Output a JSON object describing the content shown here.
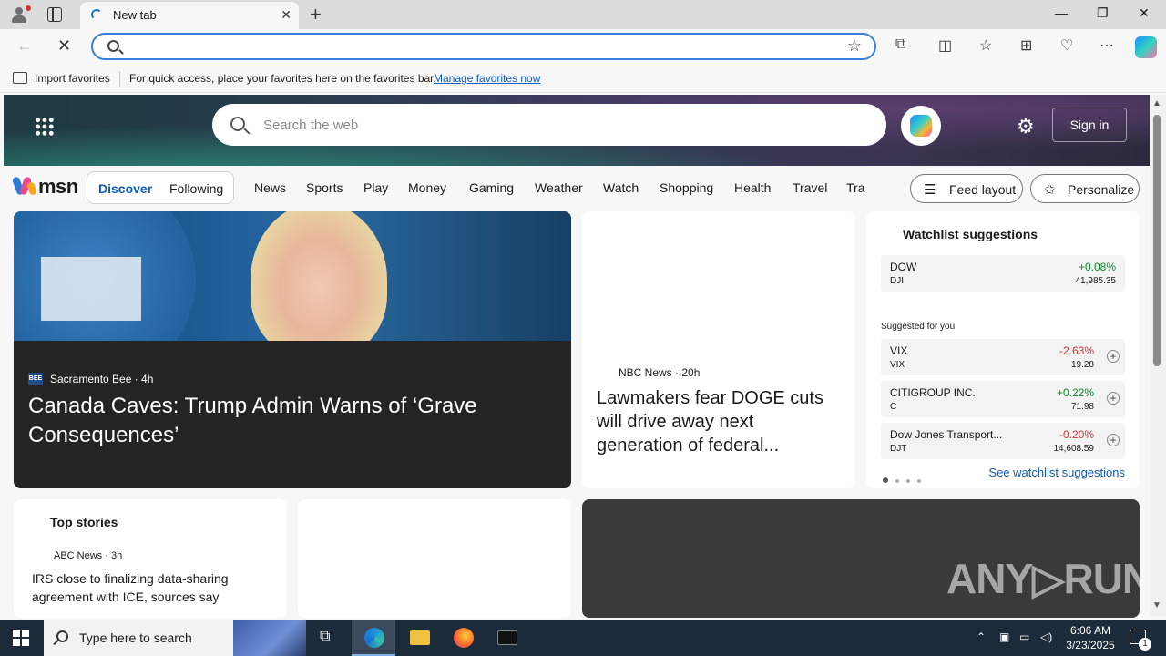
{
  "browser": {
    "tab_title": "New tab",
    "favorites_bar": {
      "import_label": "Import favorites",
      "message": "For quick access, place your favorites here on the favorites bar.",
      "manage_link": "Manage favorites now"
    }
  },
  "msn": {
    "search_placeholder": "Search the web",
    "sign_in": "Sign in",
    "logo_text": "msn",
    "feed_tabs": [
      "Discover",
      "Following"
    ],
    "categories": [
      "News",
      "Sports",
      "Play",
      "Money",
      "Gaming",
      "Weather",
      "Watch",
      "Shopping",
      "Health",
      "Travel",
      "Tra"
    ],
    "feed_layout_label": "Feed layout",
    "personalize_label": "Personalize",
    "hero": {
      "source_badge": "BEE",
      "source": "Sacramento Bee · 4h",
      "title": "Canada Caves: Trump Admin Warns of ‘Grave Consequences’"
    },
    "mid_story": {
      "source": "NBC News · 20h",
      "title": "Lawmakers fear DOGE cuts will drive away next generation of federal..."
    },
    "watchlist": {
      "title": "Watchlist suggestions",
      "suggested_label": "Suggested for you",
      "see_link": "See watchlist suggestions",
      "main": {
        "name": "DOW",
        "ticker": "DJI",
        "change": "+0.08%",
        "price": "41,985.35"
      },
      "stocks": [
        {
          "name": "VIX",
          "ticker": "VIX",
          "change": "-2.63%",
          "price": "19.28"
        },
        {
          "name": "CITIGROUP INC.",
          "ticker": "C",
          "change": "+0.22%",
          "price": "71.98"
        },
        {
          "name": "Dow Jones Transport...",
          "ticker": "DJT",
          "change": "-0.20%",
          "price": "14,608.59"
        }
      ]
    },
    "top_stories": {
      "title": "Top stories",
      "source": "ABC News · 3h",
      "headline": "IRS close to finalizing data-sharing agreement with ICE, sources say"
    },
    "watermark": "ANY▷RUN"
  },
  "taskbar": {
    "search_placeholder": "Type here to search",
    "time": "6:06 AM",
    "date": "3/23/2025",
    "notification_count": "1"
  },
  "colors": {
    "accent": "#0e5bbf",
    "positive": "#0a8a2a",
    "negative": "#d13438"
  }
}
